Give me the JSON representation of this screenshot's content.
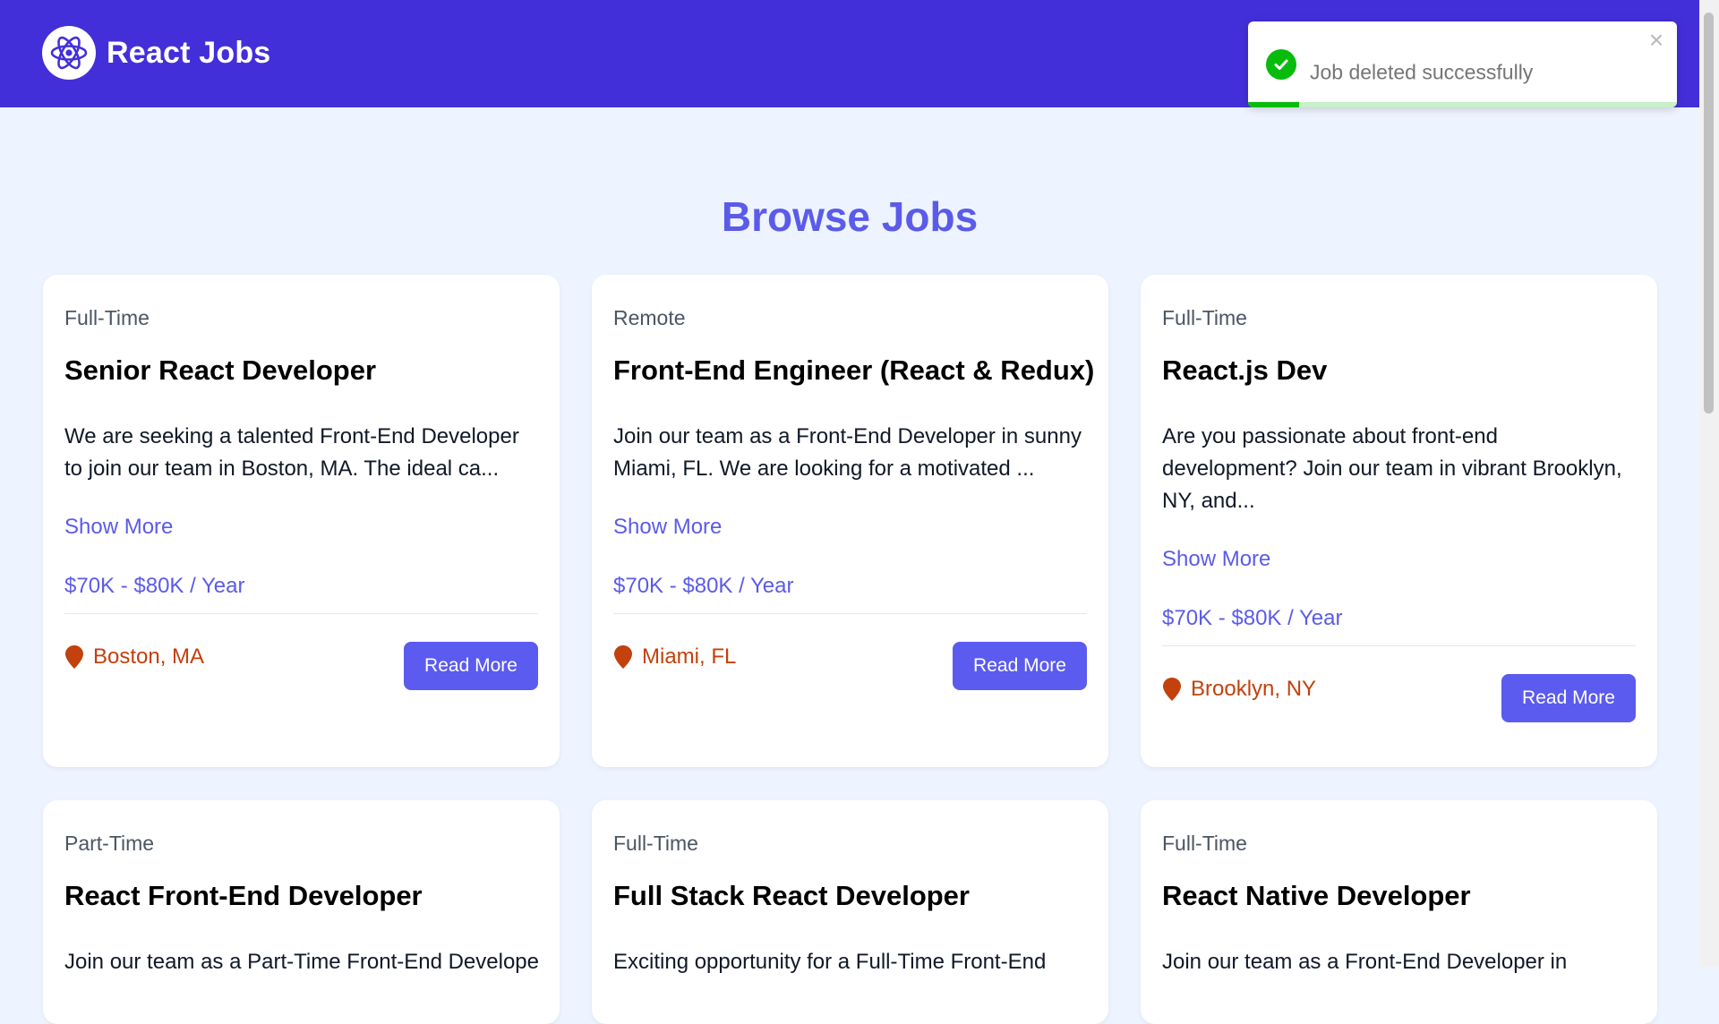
{
  "brand": {
    "name": "React Jobs",
    "logo_icon": "react-atom-icon"
  },
  "toast": {
    "message": "Job deleted successfully",
    "close": "×",
    "progress_fraction": 0.12,
    "success_color": "#07bc0c"
  },
  "heading": "Browse Jobs",
  "jobs": [
    {
      "type": "Full-Time",
      "title": "Senior React Developer",
      "description": "We are seeking a talented Front-End Developer to join our team in Boston, MA. The ideal ca...",
      "show_more": "Show More",
      "salary": "$70K - $80K / Year",
      "location": "Boston, MA",
      "read_more": "Read More"
    },
    {
      "type": "Remote",
      "title": "Front-End Engineer (React & Redux)",
      "description": "Join our team as a Front-End Developer in sunny Miami, FL. We are looking for a motivated ...",
      "show_more": "Show More",
      "salary": "$70K - $80K / Year",
      "location": "Miami, FL",
      "read_more": "Read More"
    },
    {
      "type": "Full-Time",
      "title": "React.js Dev",
      "description": "Are you passionate about front-end development? Join our team in vibrant Brooklyn, NY, and...",
      "show_more": "Show More",
      "salary": "$70K - $80K / Year",
      "location": "Brooklyn, NY",
      "read_more": "Read More"
    },
    {
      "type": "Part-Time",
      "title": "React Front-End Developer",
      "description": "Join our team as a Part-Time Front-End Developer"
    },
    {
      "type": "Full-Time",
      "title": "Full Stack React Developer",
      "description": "Exciting opportunity for a Full-Time Front-End"
    },
    {
      "type": "Full-Time",
      "title": "React Native Developer",
      "description": "Join our team as a Front-End Developer in"
    }
  ],
  "colors": {
    "nav": "#432fd9",
    "accent": "#5b5bea",
    "location": "#c2410c",
    "background": "#eef4ff"
  }
}
